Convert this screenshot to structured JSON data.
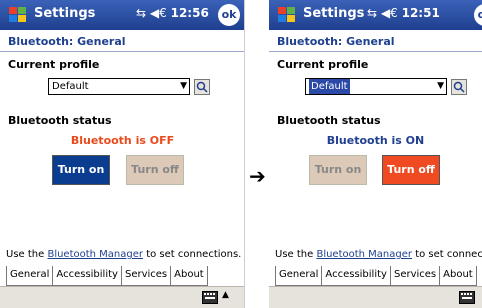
{
  "transition": {
    "arrow": "➔"
  },
  "left": {
    "title": "Settings",
    "status_icons": "⇆‡ ◀€",
    "clock": "12:56",
    "ok": "ok",
    "header": "Bluetooth: General",
    "profile_label": "Current profile",
    "profile_value": "Default",
    "status_label": "Bluetooth status",
    "status_text": "Bluetooth is OFF",
    "status_color": "#e84a1c",
    "turn_on": "Turn on",
    "turn_off": "Turn off",
    "manager_prefix": "Use the ",
    "manager_link": "Bluetooth Manager",
    "manager_suffix": " to set connections.",
    "tabs": [
      "General",
      "Accessibility",
      "Services",
      "About"
    ]
  },
  "right": {
    "title": "Settings",
    "status_icons": "‡ ◀€",
    "clock": "12:51",
    "ok": "ok",
    "header": "Bluetooth: General",
    "profile_label": "Current profile",
    "profile_value": "Default",
    "status_label": "Bluetooth status",
    "status_text": "Bluetooth is ON",
    "status_color": "#1f3f8f",
    "turn_on": "Turn on",
    "turn_off": "Turn off",
    "manager_prefix": "Use the ",
    "manager_link": "Bluetooth Manager",
    "manager_suffix": " to set connections",
    "tabs": [
      "General",
      "Accessibility",
      "Services",
      "About"
    ]
  },
  "icons": {
    "start": "windows-start-icon",
    "search": "profile-search-icon",
    "keyboard": "keyboard-icon",
    "up": "input-menu-up-icon"
  }
}
